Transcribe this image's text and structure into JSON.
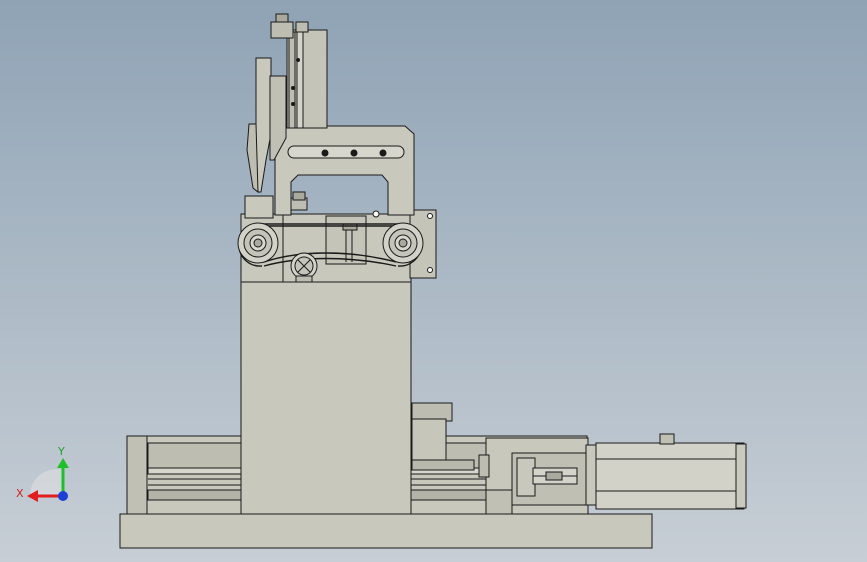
{
  "scene": {
    "colors": {
      "background_top": "#8fa3b5",
      "background_bottom": "#c7ced5",
      "part_fill": "#c8c8bc",
      "part_dark": "#a9a99e",
      "edge": "#1a1a1a",
      "motor": "#d2d2c8",
      "axis_x": "#e11d1d",
      "axis_y": "#1fbf2a",
      "axis_z": "#1c3fd6"
    }
  },
  "triad": {
    "x_label": "X",
    "y_label": "Y"
  }
}
